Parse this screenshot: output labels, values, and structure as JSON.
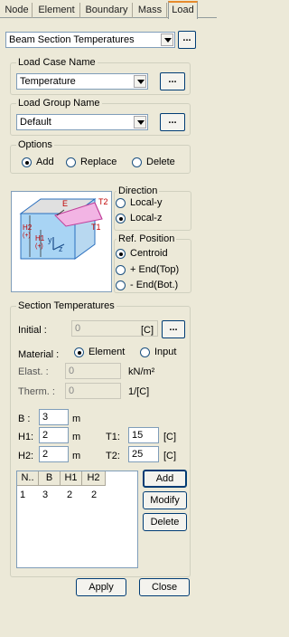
{
  "tabs": [
    "Node",
    "Element",
    "Boundary",
    "Mass",
    "Load"
  ],
  "function_select": "Beam Section Temperatures",
  "load_case": {
    "title": "Load Case Name",
    "value": "Temperature"
  },
  "load_group": {
    "title": "Load Group Name",
    "value": "Default"
  },
  "options": {
    "title": "Options",
    "add": "Add",
    "replace": "Replace",
    "delete": "Delete"
  },
  "diagram": {
    "E": "E",
    "T2": "T2",
    "T1": "T1",
    "H2": "H2",
    "H2s": "(+)",
    "H1": "H1",
    "H1s": "(+)",
    "y": "y",
    "z": "z"
  },
  "direction": {
    "title": "Direction",
    "local_y": "Local-y",
    "local_z": "Local-z"
  },
  "ref_position": {
    "title": "Ref. Position",
    "centroid": "Centroid",
    "end_top": "+ End(Top)",
    "end_bot": "- End(Bot.)"
  },
  "section_temps": {
    "title": "Section Temperatures",
    "initial_label": "Initial :",
    "initial_value": "0",
    "temp_unit": "[C]",
    "material_label": "Material :",
    "element": "Element",
    "input": "Input",
    "elast_label": "Elast.  :",
    "elast_value": "0",
    "elast_unit": "kN/m²",
    "therm_label": "Therm. :",
    "therm_value": "0",
    "therm_unit": "1/[C]",
    "b_label": "B :",
    "b_value": "3",
    "b_unit": "m",
    "h1_label": "H1:",
    "h1_value": "2",
    "h1_unit": "m",
    "h2_label": "H2:",
    "h2_value": "2",
    "h2_unit": "m",
    "t1_label": "T1:",
    "t1_value": "15",
    "t1_unit": "[C]",
    "t2_label": "T2:",
    "t2_value": "25",
    "t2_unit": "[C]"
  },
  "table": {
    "headers": [
      "N..",
      "B",
      "H1",
      "H2"
    ],
    "rows": [
      [
        "1",
        "3",
        "2",
        "2"
      ]
    ]
  },
  "buttons": {
    "add": "Add",
    "modify": "Modify",
    "delete": "Delete",
    "apply": "Apply",
    "close": "Close",
    "dots": "..."
  }
}
